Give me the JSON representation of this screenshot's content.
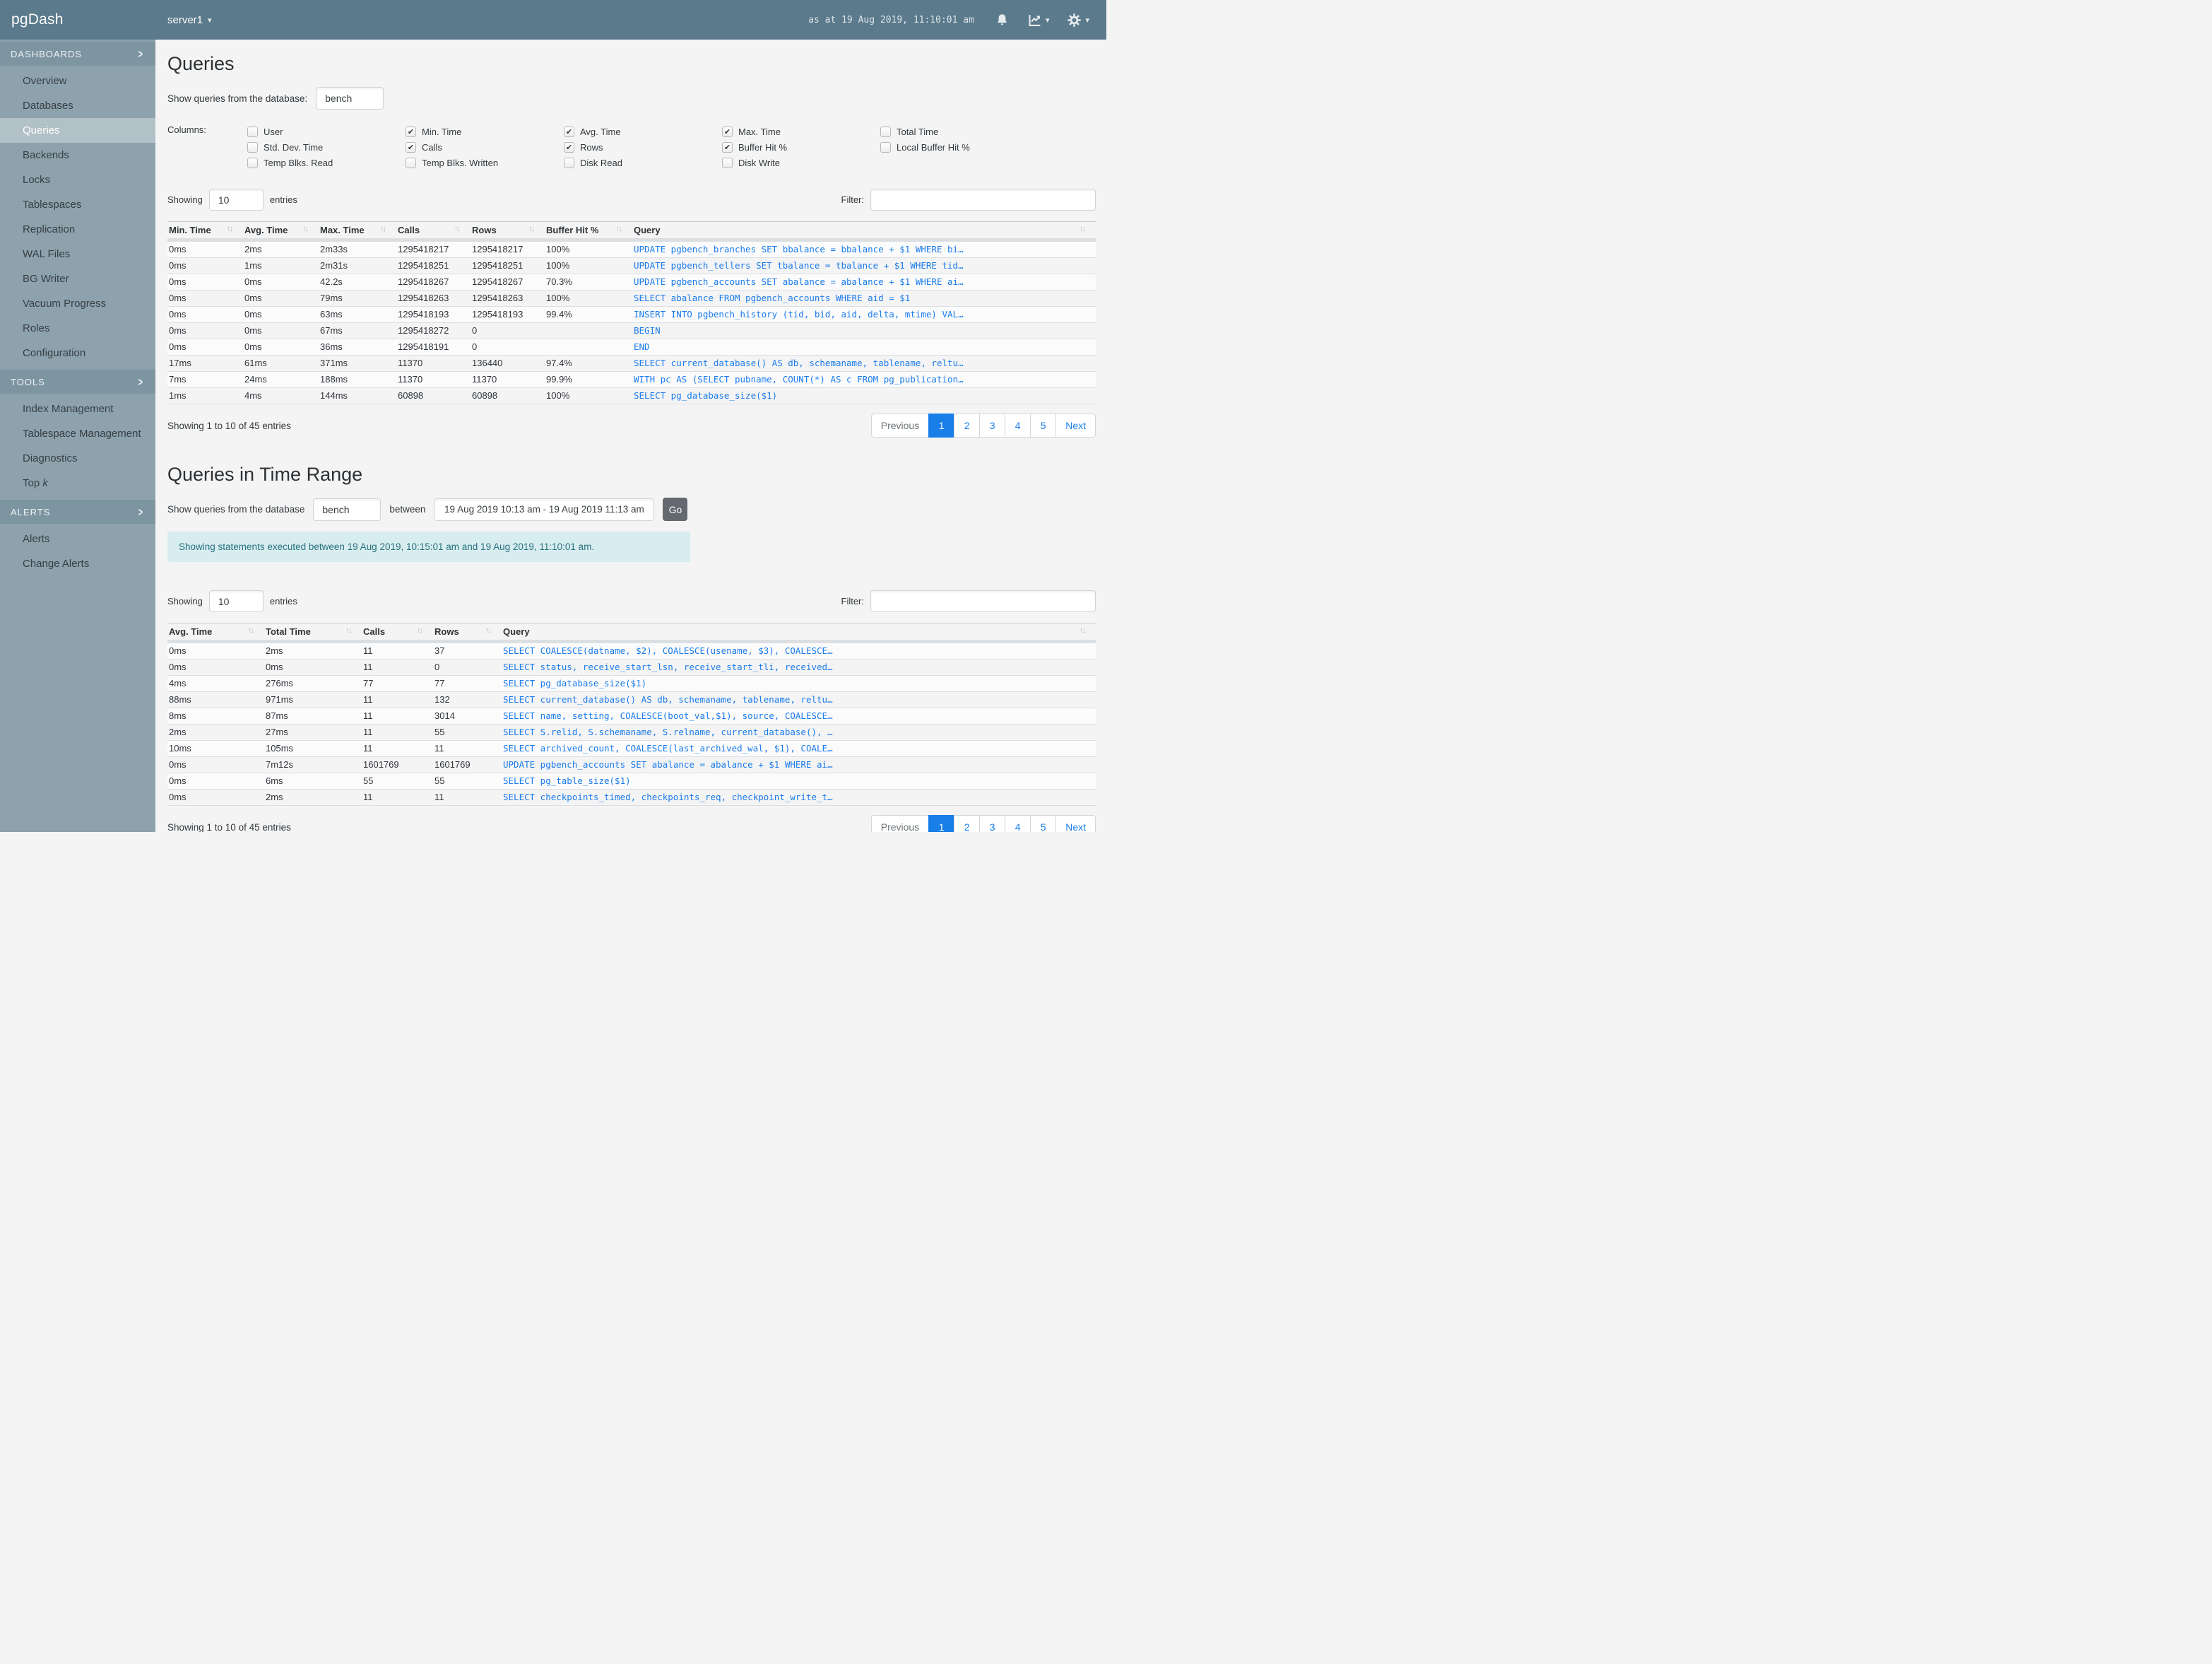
{
  "colors": {
    "topbar": "#5b7a8c",
    "sidebar": "#8da2ad",
    "sidebar_header": "#7d95a1",
    "sidebar_active": "#b2c0c7",
    "accent": "#187ee8",
    "link": "#1b7ceb",
    "notice_bg": "#d8edf0",
    "notice_text": "#26717e",
    "go_button": "#63696e"
  },
  "topbar": {
    "brand": "pgDash",
    "server": "server1",
    "timestamp": "as at 19 Aug 2019, 11:10:01 am"
  },
  "sidebar": {
    "sections": [
      {
        "label": "DASHBOARDS",
        "items": [
          {
            "label": "Overview"
          },
          {
            "label": "Databases"
          },
          {
            "label": "Queries",
            "selected": true
          },
          {
            "label": "Backends"
          },
          {
            "label": "Locks"
          },
          {
            "label": "Tablespaces"
          },
          {
            "label": "Replication"
          },
          {
            "label": "WAL Files"
          },
          {
            "label": "BG Writer"
          },
          {
            "label": "Vacuum Progress"
          },
          {
            "label": "Roles"
          },
          {
            "label": "Configuration"
          }
        ]
      },
      {
        "label": "TOOLS",
        "items": [
          {
            "label": "Index Management"
          },
          {
            "label": "Tablespace Management"
          },
          {
            "label": "Diagnostics"
          },
          {
            "label": "Top ",
            "italic": "k"
          }
        ]
      },
      {
        "label": "ALERTS",
        "items": [
          {
            "label": "Alerts"
          },
          {
            "label": "Change Alerts"
          }
        ]
      }
    ]
  },
  "queries": {
    "title": "Queries",
    "db_label": "Show queries from the database:",
    "db_value": "bench",
    "columns_label": "Columns:",
    "column_groups": [
      [
        {
          "label": "User",
          "checked": false
        },
        {
          "label": "Std. Dev. Time",
          "checked": false
        },
        {
          "label": "Temp Blks. Read",
          "checked": false
        }
      ],
      [
        {
          "label": "Min. Time",
          "checked": true
        },
        {
          "label": "Calls",
          "checked": true
        },
        {
          "label": "Temp Blks. Written",
          "checked": false
        }
      ],
      [
        {
          "label": "Avg. Time",
          "checked": true
        },
        {
          "label": "Rows",
          "checked": true
        },
        {
          "label": "Disk Read",
          "checked": false
        }
      ],
      [
        {
          "label": "Max. Time",
          "checked": true
        },
        {
          "label": "Buffer Hit %",
          "checked": true
        },
        {
          "label": "Disk Write",
          "checked": false
        }
      ],
      [
        {
          "label": "Total Time",
          "checked": false
        },
        {
          "label": "Local Buffer Hit %",
          "checked": false
        }
      ]
    ],
    "showing": {
      "pre": "Showing",
      "value": "10",
      "post": "entries"
    },
    "filter": {
      "label": "Filter:",
      "value": ""
    },
    "table": {
      "columns": [
        "Min. Time",
        "Avg. Time",
        "Max. Time",
        "Calls",
        "Rows",
        "Buffer Hit %",
        "Query"
      ],
      "rows": [
        [
          "0ms",
          "2ms",
          "2m33s",
          "1295418217",
          "1295418217",
          "100%",
          "UPDATE pgbench_branches SET bbalance = bbalance + $1 WHERE bi…"
        ],
        [
          "0ms",
          "1ms",
          "2m31s",
          "1295418251",
          "1295418251",
          "100%",
          "UPDATE pgbench_tellers SET tbalance = tbalance + $1 WHERE tid…"
        ],
        [
          "0ms",
          "0ms",
          "42.2s",
          "1295418267",
          "1295418267",
          "70.3%",
          "UPDATE pgbench_accounts SET abalance = abalance + $1 WHERE ai…"
        ],
        [
          "0ms",
          "0ms",
          "79ms",
          "1295418263",
          "1295418263",
          "100%",
          "SELECT abalance FROM pgbench_accounts WHERE aid = $1"
        ],
        [
          "0ms",
          "0ms",
          "63ms",
          "1295418193",
          "1295418193",
          "99.4%",
          "INSERT INTO pgbench_history (tid, bid, aid, delta, mtime) VAL…"
        ],
        [
          "0ms",
          "0ms",
          "67ms",
          "1295418272",
          "0",
          "",
          "BEGIN"
        ],
        [
          "0ms",
          "0ms",
          "36ms",
          "1295418191",
          "0",
          "",
          "END"
        ],
        [
          "17ms",
          "61ms",
          "371ms",
          "11370",
          "136440",
          "97.4%",
          "SELECT current_database() AS db, schemaname, tablename, reltu…"
        ],
        [
          "7ms",
          "24ms",
          "188ms",
          "11370",
          "11370",
          "99.9%",
          "WITH pc AS (SELECT pubname, COUNT(*) AS c FROM pg_publication…"
        ],
        [
          "1ms",
          "4ms",
          "144ms",
          "60898",
          "60898",
          "100%",
          "SELECT pg_database_size($1)"
        ]
      ]
    },
    "summary": "Showing 1 to 10 of 45 entries",
    "pagination": {
      "previous": "Previous",
      "pages": [
        "1",
        "2",
        "3",
        "4",
        "5"
      ],
      "active": "1",
      "next": "Next"
    }
  },
  "time_range": {
    "title": "Queries in Time Range",
    "db_label": "Show queries from the database",
    "db_value": "bench",
    "between_label": "between",
    "range_value": "19 Aug 2019 10:13 am - 19 Aug 2019 11:13 am",
    "go_label": "Go",
    "notice": "Showing statements executed between 19 Aug 2019, 10:15:01 am and 19 Aug 2019, 11:10:01 am.",
    "showing": {
      "pre": "Showing",
      "value": "10",
      "post": "entries"
    },
    "filter": {
      "label": "Filter:",
      "value": ""
    },
    "table": {
      "columns": [
        "Avg. Time",
        "Total Time",
        "Calls",
        "Rows",
        "Query"
      ],
      "rows": [
        [
          "0ms",
          "2ms",
          "11",
          "37",
          "SELECT COALESCE(datname, $2), COALESCE(usename, $3), COALESCE…"
        ],
        [
          "0ms",
          "0ms",
          "11",
          "0",
          "SELECT status, receive_start_lsn, receive_start_tli, received…"
        ],
        [
          "4ms",
          "276ms",
          "77",
          "77",
          "SELECT pg_database_size($1)"
        ],
        [
          "88ms",
          "971ms",
          "11",
          "132",
          "SELECT current_database() AS db, schemaname, tablename, reltu…"
        ],
        [
          "8ms",
          "87ms",
          "11",
          "3014",
          "SELECT name, setting, COALESCE(boot_val,$1), source, COALESCE…"
        ],
        [
          "2ms",
          "27ms",
          "11",
          "55",
          "SELECT S.relid, S.schemaname, S.relname, current_database(), …"
        ],
        [
          "10ms",
          "105ms",
          "11",
          "11",
          "SELECT archived_count, COALESCE(last_archived_wal, $1), COALE…"
        ],
        [
          "0ms",
          "7m12s",
          "1601769",
          "1601769",
          "UPDATE pgbench_accounts SET abalance = abalance + $1 WHERE ai…"
        ],
        [
          "0ms",
          "6ms",
          "55",
          "55",
          "SELECT pg_table_size($1)"
        ],
        [
          "0ms",
          "2ms",
          "11",
          "11",
          "SELECT checkpoints_timed, checkpoints_req, checkpoint_write_t…"
        ]
      ]
    },
    "summary": "Showing 1 to 10 of 45 entries",
    "pagination": {
      "previous": "Previous",
      "pages": [
        "1",
        "2",
        "3",
        "4",
        "5"
      ],
      "active": "1",
      "next": "Next"
    }
  }
}
